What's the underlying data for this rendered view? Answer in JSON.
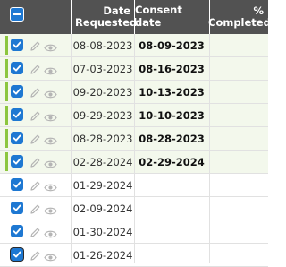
{
  "header": {
    "date_requested": "Date Requested",
    "consent_date": "Consent date",
    "pct_completed": "% Completed"
  },
  "colors": {
    "header_bg": "#525252",
    "checkbox": "#1e78d2",
    "consented_bar": "#8cc63f",
    "consented_row_bg": "#f3f8ec"
  },
  "icons": {
    "select_all": "minus-checkbox-icon",
    "row_check": "checkmark-icon",
    "edit": "pencil-icon",
    "view": "eye-icon"
  },
  "rows": [
    {
      "date_requested": "08-08-2023",
      "consent_date": "08-09-2023",
      "consented": true
    },
    {
      "date_requested": "07-03-2023",
      "consent_date": "08-16-2023",
      "consented": true
    },
    {
      "date_requested": "09-20-2023",
      "consent_date": "10-13-2023",
      "consented": true
    },
    {
      "date_requested": "09-29-2023",
      "consent_date": "10-10-2023",
      "consented": true
    },
    {
      "date_requested": "08-28-2023",
      "consent_date": "08-28-2023",
      "consented": true
    },
    {
      "date_requested": "02-28-2024",
      "consent_date": "02-29-2024",
      "consented": true
    },
    {
      "date_requested": "01-29-2024",
      "consent_date": "",
      "consented": false
    },
    {
      "date_requested": "02-09-2024",
      "consent_date": "",
      "consented": false
    },
    {
      "date_requested": "01-30-2024",
      "consent_date": "",
      "consented": false
    },
    {
      "date_requested": "01-26-2024",
      "consent_date": "",
      "consented": false
    }
  ]
}
